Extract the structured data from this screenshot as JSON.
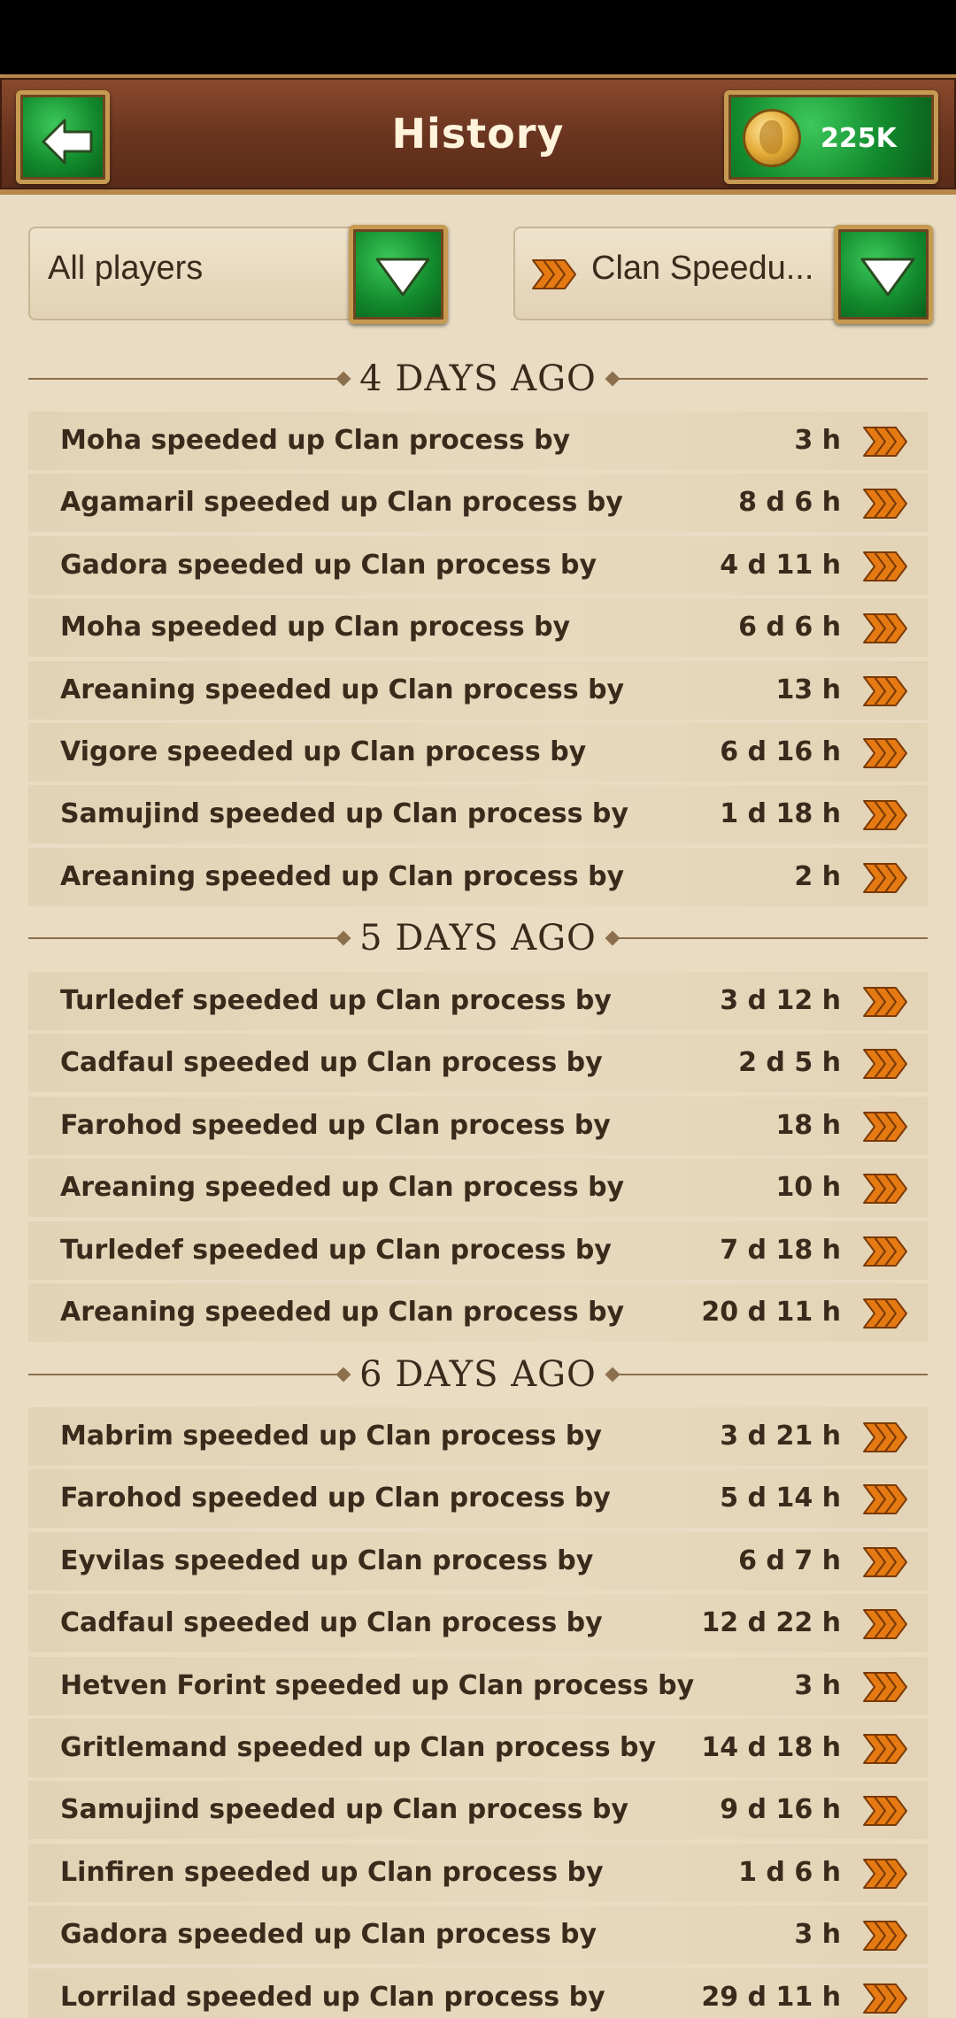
{
  "header": {
    "title": "History",
    "coins": "225K"
  },
  "filters": {
    "players": "All players",
    "type": "Clan Speedu..."
  },
  "icons": {
    "back": "back-arrow-icon",
    "coin": "gold-coin-icon",
    "dropdown": "triangle-down-icon",
    "speedup": "speedup-chevrons-icon"
  },
  "colors": {
    "gem_green": "#128a2c",
    "header_brown": "#6b3520",
    "gold_trim": "#c79a52",
    "chevron_orange": "#e67a12"
  },
  "sections": [
    {
      "label": "4 DAYS AGO",
      "rows": [
        {
          "text": "Moha speeded up Clan process by",
          "value": "3 h"
        },
        {
          "text": "Agamaril speeded up Clan process by",
          "value": "8 d 6 h"
        },
        {
          "text": "Gadora speeded up Clan process by",
          "value": "4 d 11 h"
        },
        {
          "text": "Moha speeded up Clan process by",
          "value": "6 d 6 h"
        },
        {
          "text": "Areaning speeded up Clan process by",
          "value": "13 h"
        },
        {
          "text": "Vigore speeded up Clan process by",
          "value": "6 d 16 h"
        },
        {
          "text": "Samujind speeded up Clan process by",
          "value": "1 d 18 h"
        },
        {
          "text": "Areaning speeded up Clan process by",
          "value": "2 h"
        }
      ]
    },
    {
      "label": "5 DAYS AGO",
      "rows": [
        {
          "text": "Turledef speeded up Clan process by",
          "value": "3 d 12 h"
        },
        {
          "text": "Cadfaul speeded up Clan process by",
          "value": "2 d 5 h"
        },
        {
          "text": "Farohod speeded up Clan process by",
          "value": "18 h"
        },
        {
          "text": "Areaning speeded up Clan process by",
          "value": "10 h"
        },
        {
          "text": "Turledef speeded up Clan process by",
          "value": "7 d 18 h"
        },
        {
          "text": "Areaning speeded up Clan process by",
          "value": "20 d 11 h"
        }
      ]
    },
    {
      "label": "6 DAYS AGO",
      "rows": [
        {
          "text": "Mabrim speeded up Clan process by",
          "value": "3 d 21 h"
        },
        {
          "text": "Farohod speeded up Clan process by",
          "value": "5 d 14 h"
        },
        {
          "text": "Eyvilas speeded up Clan process by",
          "value": "6 d 7 h"
        },
        {
          "text": "Cadfaul speeded up Clan process by",
          "value": "12 d 22 h"
        },
        {
          "text": "Hetven Forint speeded up Clan process by",
          "value": "3 h"
        },
        {
          "text": "Gritlemand speeded up Clan process by",
          "value": "14 d 18 h"
        },
        {
          "text": "Samujind speeded up Clan process by",
          "value": "9 d 16 h"
        },
        {
          "text": "Linfiren speeded up Clan process by",
          "value": "1 d 6 h"
        },
        {
          "text": "Gadora speeded up Clan process by",
          "value": "3 h"
        },
        {
          "text": "Lorrilad speeded up Clan process by",
          "value": "29 d 11 h"
        }
      ]
    }
  ]
}
